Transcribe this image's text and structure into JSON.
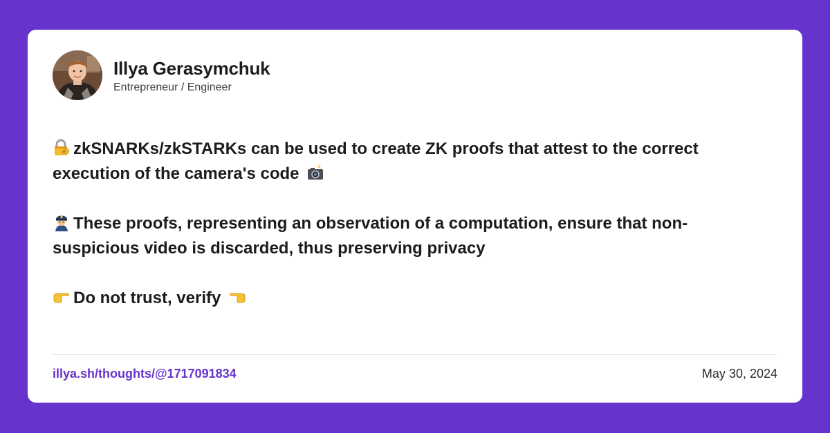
{
  "theme": {
    "background": "#6633cc",
    "card": "#ffffff",
    "accent": "#6633cc",
    "text": "#1c1c1e"
  },
  "author": {
    "name": "Illya Gerasymchuk",
    "role": "Entrepreneur / Engineer",
    "avatar": "profile-photo"
  },
  "post": {
    "paragraphs": [
      {
        "icon": "locked-with-key-emoji",
        "text": "zkSNARKs/zkSTARKs can be used to create ZK proofs that attest to the correct execution of the camera's code",
        "trailing_icon": "camera-with-flash-emoji"
      },
      {
        "icon": "police-officer-emoji",
        "text": "These proofs, representing an observation of a computation, ensure that non-suspicious video is discarded, thus preserving privacy"
      },
      {
        "icon": "pointing-right-emoji",
        "text": "Do not trust, verify",
        "trailing_icon": "pointing-left-emoji"
      }
    ]
  },
  "footer": {
    "link": "illya.sh/thoughts/@1717091834",
    "date": "May 30, 2024"
  }
}
